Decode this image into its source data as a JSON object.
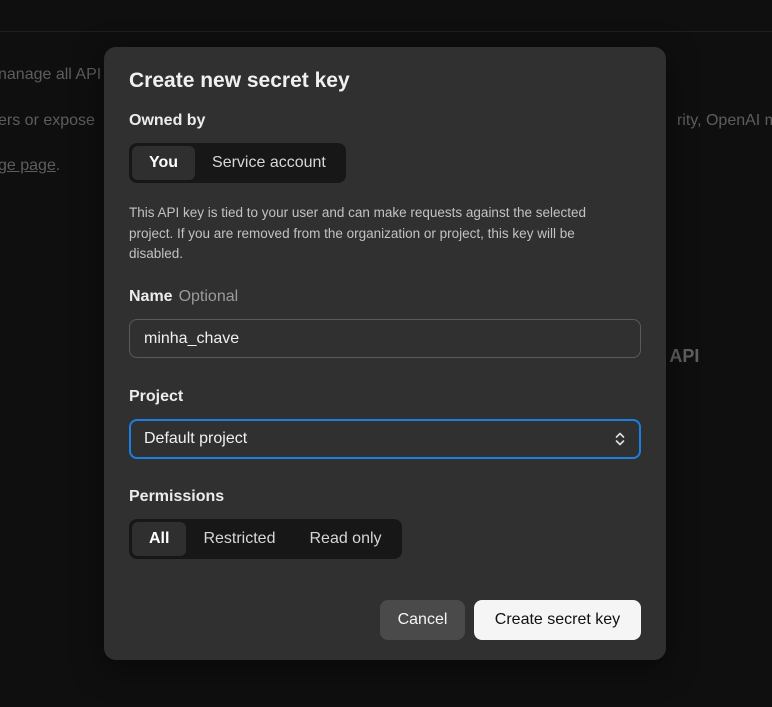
{
  "background": {
    "line1": "nanage all API",
    "line2_left": "ers or expose",
    "line2_right": "rity, OpenAI m",
    "line3_link": "ge page",
    "line3_suffix": ".",
    "heading": "I API"
  },
  "modal": {
    "title": "Create new secret key",
    "owned_by": {
      "label": "Owned by",
      "options": [
        "You",
        "Service account"
      ],
      "selected": "You"
    },
    "help_text": "This API key is tied to your user and can make requests against the selected project. If you are removed from the organization or project, this key will be disabled.",
    "name": {
      "label": "Name",
      "optional": "Optional",
      "value": "minha_chave"
    },
    "project": {
      "label": "Project",
      "value": "Default project",
      "icon": "chevron-up-down-icon"
    },
    "permissions": {
      "label": "Permissions",
      "options": [
        "All",
        "Restricted",
        "Read only"
      ],
      "selected": "All"
    },
    "actions": {
      "cancel": "Cancel",
      "create": "Create secret key"
    }
  },
  "colors": {
    "modal_bg": "#303030",
    "page_bg": "#0f0f0f",
    "focus_ring": "#1a7fe0",
    "primary_button": "#f5f5f5"
  }
}
